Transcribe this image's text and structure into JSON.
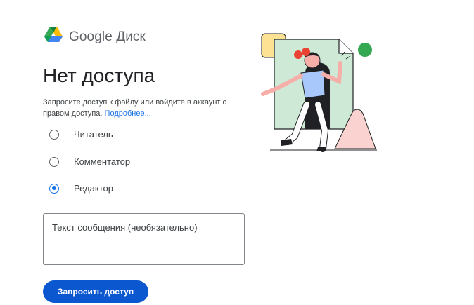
{
  "header": {
    "brand": "Google Диск",
    "logo_icon": "google-drive-logo"
  },
  "page": {
    "title": "Нет доступа",
    "description_text": "Запросите доступ к файлу или войдите в аккаунт с правом доступа. ",
    "learn_more_link": "Подробнее..."
  },
  "roles": {
    "options": [
      {
        "label": "Читатель",
        "selected": false
      },
      {
        "label": "Комментатор",
        "selected": false
      },
      {
        "label": "Редактор",
        "selected": true
      }
    ]
  },
  "message": {
    "placeholder": "Текст сообщения (необязательно)"
  },
  "actions": {
    "request_button": "Запросить доступ"
  },
  "colors": {
    "accent": "#1a73e8",
    "button": "#0b57d0",
    "drive_green": "#34a853",
    "drive_yellow": "#fbbc04",
    "drive_blue": "#4285f4",
    "illustration_green": "#ceead6",
    "illustration_pink": "#fad2cf",
    "illustration_red": "#ea4335"
  }
}
